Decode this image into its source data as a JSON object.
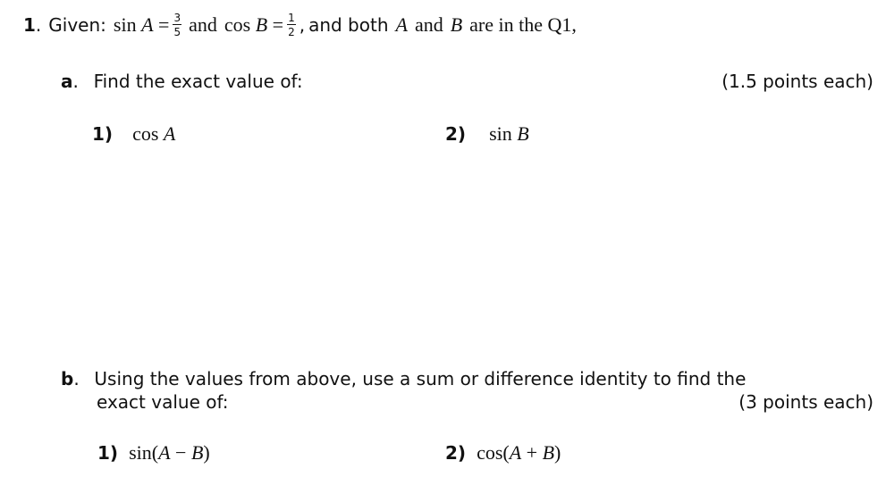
{
  "question": {
    "number": "1",
    "number_suffix": ".",
    "given_label": "Given:",
    "sinA": {
      "func": "sin",
      "var": "A",
      "equals": "=",
      "numerator": "3",
      "denominator": "5"
    },
    "and1": "and",
    "cosB": {
      "func": "cos",
      "var": "B",
      "equals": "=",
      "numerator": "1",
      "denominator": "2"
    },
    "comma": ",",
    "and_both": "and both",
    "var_A": "A",
    "and2": "and",
    "var_B": "B",
    "tail": "are in the Q1,"
  },
  "part_a": {
    "letter": "a",
    "letter_suffix": ".",
    "instruction": "Find the exact value of:",
    "points": "(1.5 points each)",
    "items": [
      {
        "label": "1)",
        "func": "cos",
        "arg": "A"
      },
      {
        "label": "2)",
        "func": "sin",
        "arg": "B"
      }
    ]
  },
  "part_b": {
    "letter": "b",
    "letter_suffix": ".",
    "instruction_line1": "Using the values from above, use a sum or difference identity to find the",
    "instruction_line2": "exact value of:",
    "points": "(3 points each)",
    "items": [
      {
        "label": "1)",
        "func": "sin",
        "open": "(",
        "a": "A",
        "op": "−",
        "b": "B",
        "close": ")"
      },
      {
        "label": "2)",
        "func": "cos",
        "open": "(",
        "a": "A",
        "op": "+",
        "b": "B",
        "close": ")"
      }
    ]
  }
}
